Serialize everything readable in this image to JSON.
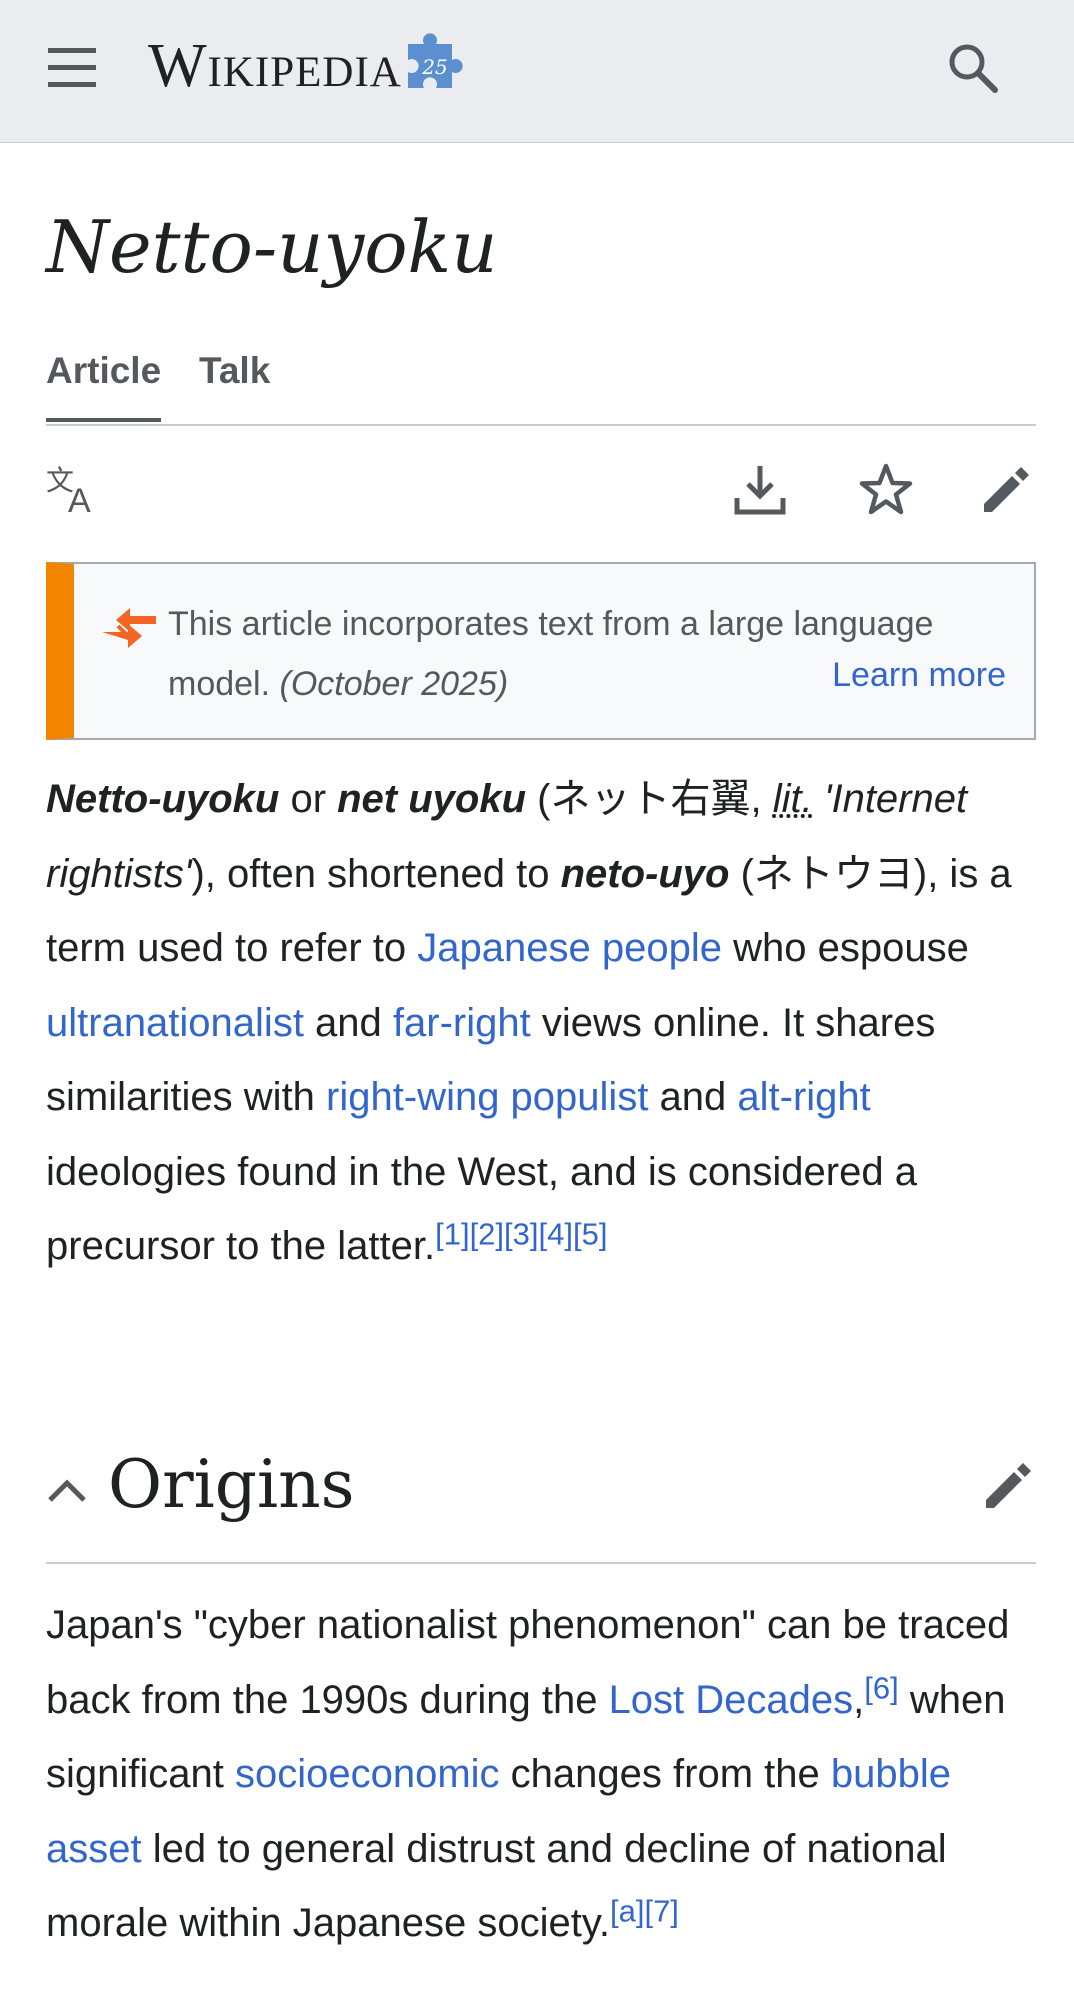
{
  "header": {
    "logo_text": "Wikipedia",
    "puzzle_number": "25"
  },
  "page": {
    "title": "Netto-uyoku"
  },
  "tabs": [
    {
      "label": "Article",
      "active": true
    },
    {
      "label": "Talk",
      "active": false
    }
  ],
  "notice": {
    "text": "This article incorporates text from a large language model.",
    "date": "(October 2025)",
    "learn_more": "Learn more"
  },
  "intro": {
    "term1": "Netto-uyoku",
    "or": " or ",
    "term2": "net uyoku",
    "jp_open": " (ネット右翼, ",
    "lit": "lit.",
    "translation": " 'Internet rightists'",
    "after_translation": "), often shortened to ",
    "term3": "neto-uyo",
    "jp2": " (ネトウヨ), is a term used to refer to ",
    "link_japanese_people": "Japanese people",
    "t1": " who espouse ",
    "link_ultranationalist": "ultranationalist",
    "t2": " and ",
    "link_far_right": "far-right",
    "t3": " views online. It shares similarities with ",
    "link_right_wing_populist": "right-wing populist",
    "t4": " and ",
    "link_alt_right": "alt-right",
    "t5": " ideologies found in the West, and is considered a precursor to the latter.",
    "refs": [
      "[1]",
      "[2]",
      "[3]",
      "[4]",
      "[5]"
    ]
  },
  "section": {
    "title": "Origins"
  },
  "origins": {
    "t1": "Japan's \"cyber nationalist phenomenon\" can be traced back from the 1990s during the ",
    "link_lost_decades": "Lost Decades",
    "comma": ",",
    "ref6": "[6]",
    "t2": " when significant ",
    "link_socioeconomic": "socioeconomic",
    "t3": " changes from the ",
    "link_bubble_asset": "bubble asset",
    "t4": " led to general distrust and decline of national morale within Japanese society.",
    "ref_a": "[a]",
    "ref7": "[7]"
  },
  "colors": {
    "link": "#3366cc",
    "notice_accent": "#f28500",
    "header_bg": "#eaecf0",
    "text": "#202122",
    "icon": "#54595d"
  },
  "icons": [
    "menu-icon",
    "search-icon",
    "language-icon",
    "download-icon",
    "star-icon",
    "edit-icon",
    "chevron-up-icon",
    "llm-notice-icon",
    "puzzle-icon"
  ]
}
